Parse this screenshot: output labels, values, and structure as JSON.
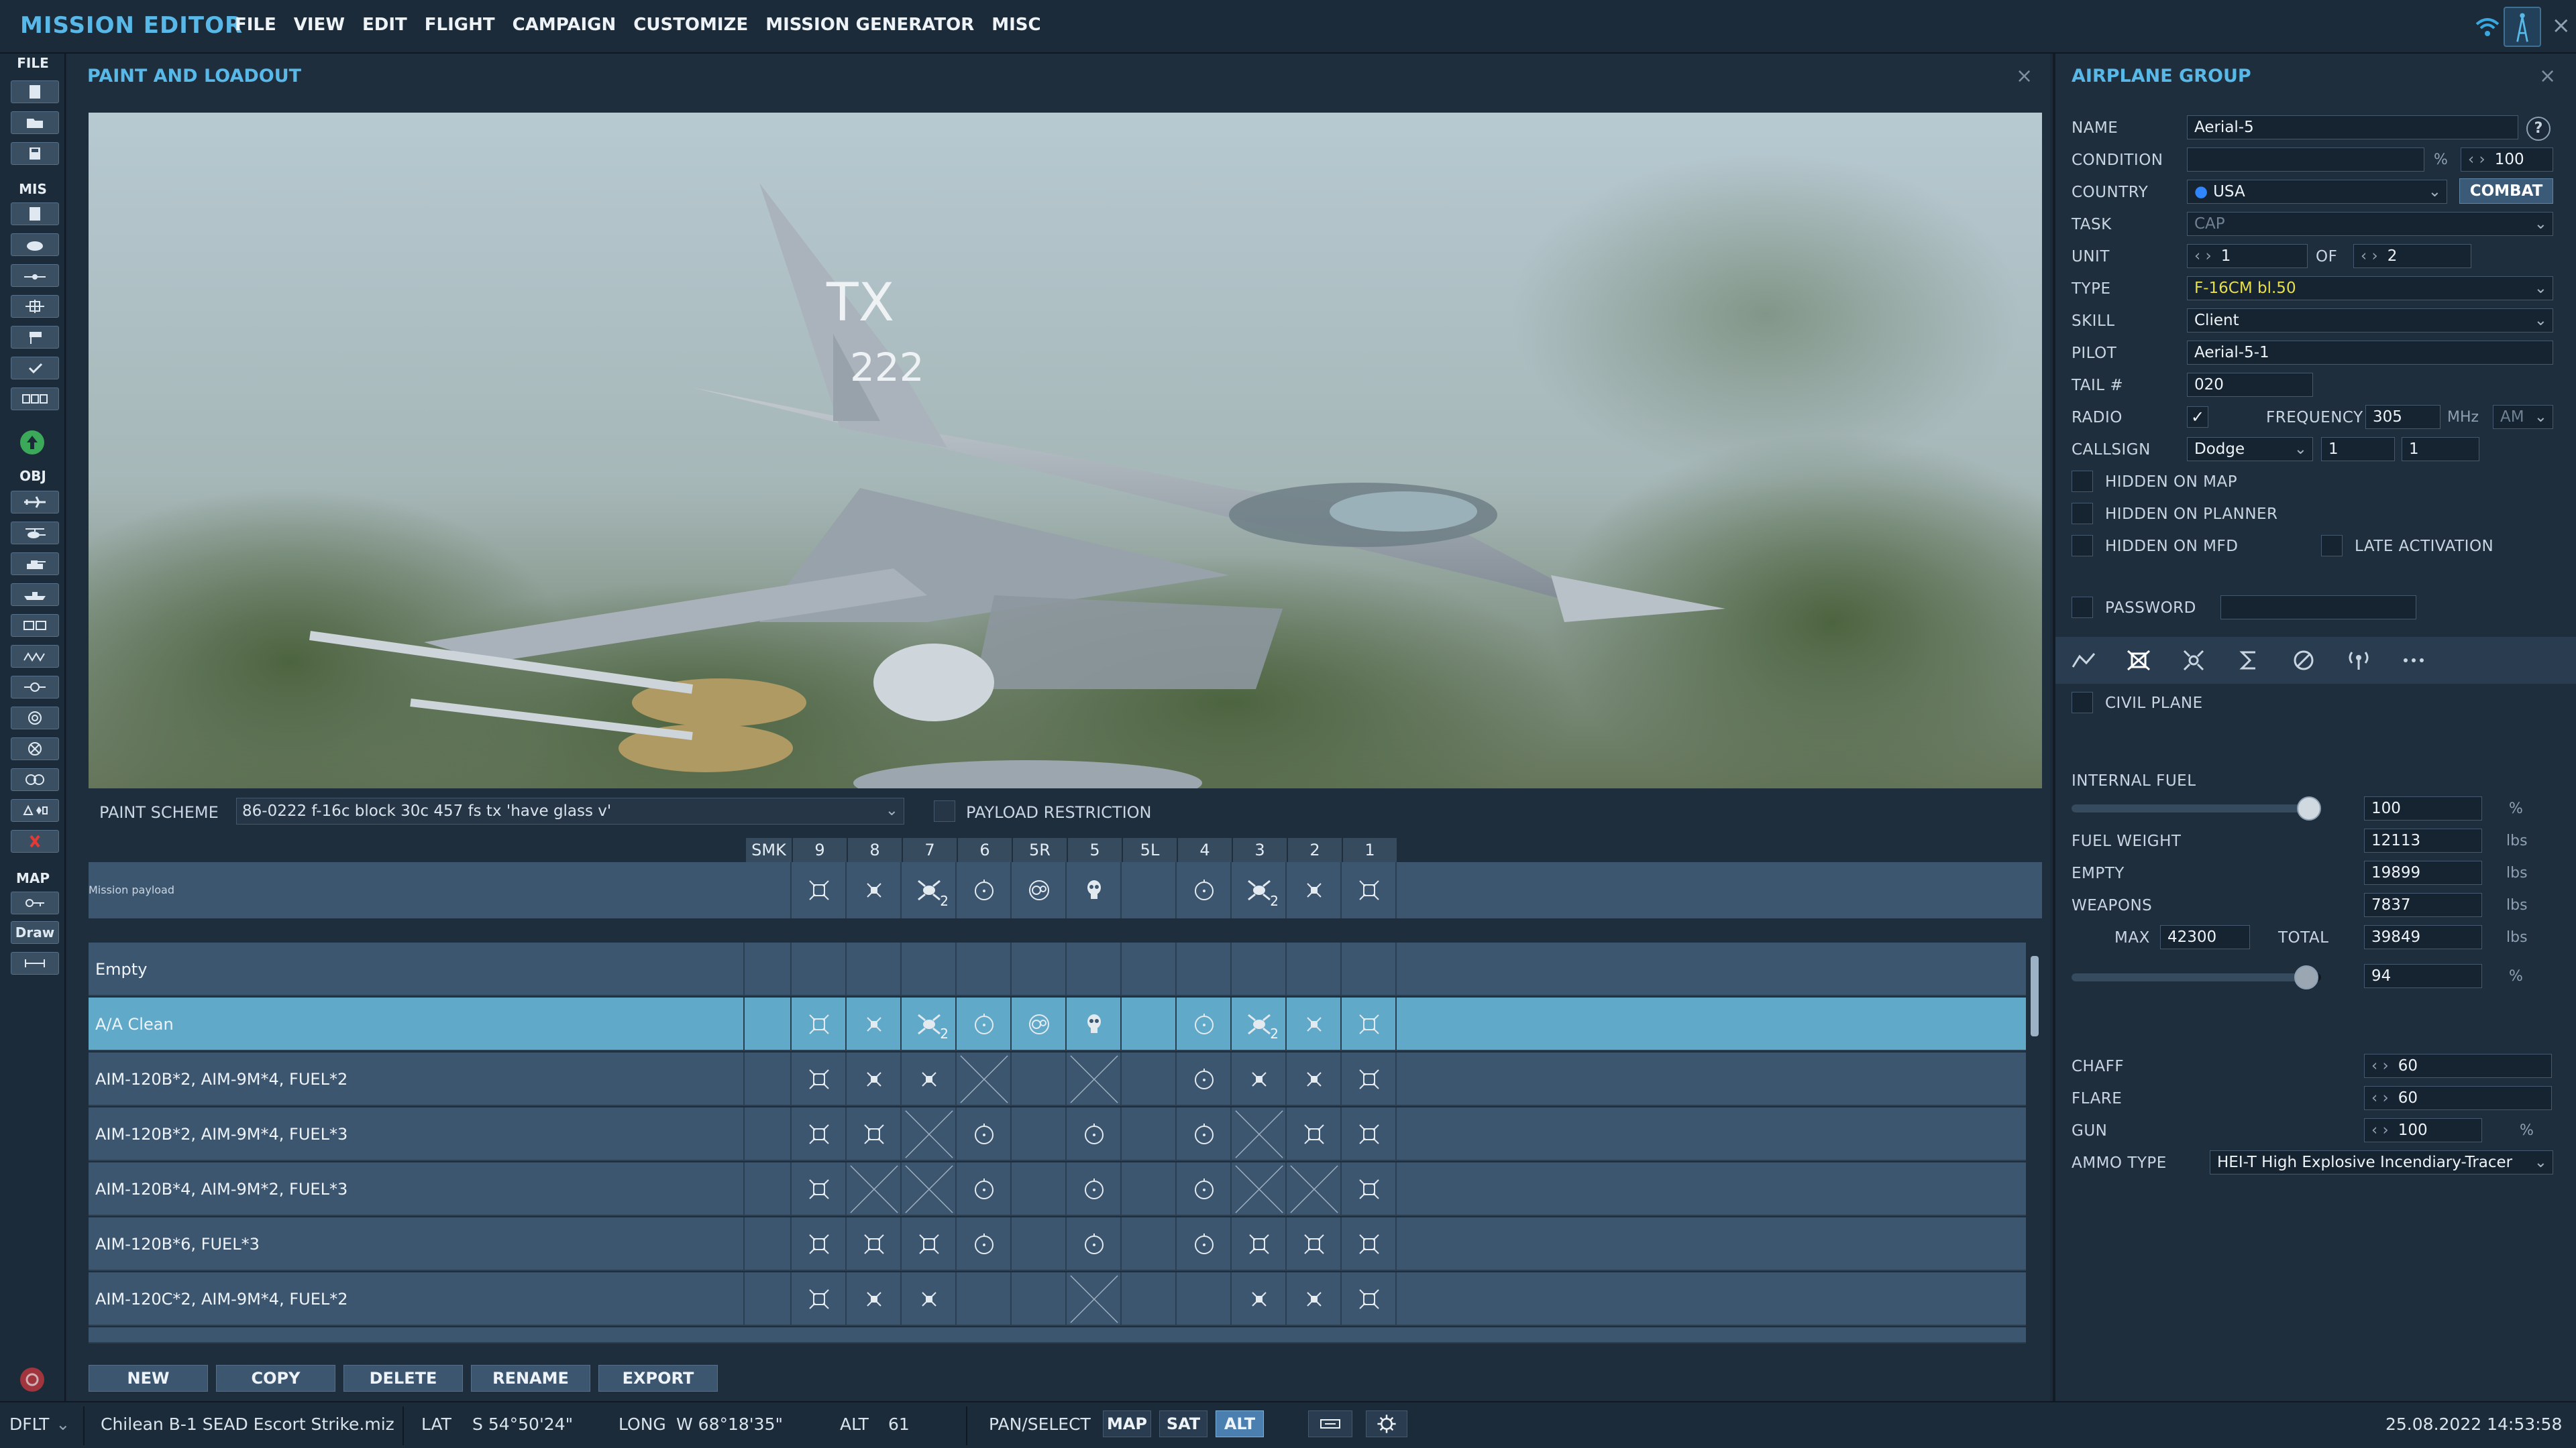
{
  "app": {
    "title": "MISSION EDITOR",
    "menu": [
      "FILE",
      "VIEW",
      "EDIT",
      "FLIGHT",
      "CAMPAIGN",
      "CUSTOMIZE",
      "MISSION GENERATOR",
      "MISC"
    ],
    "close": "×"
  },
  "toolbar": {
    "sections": {
      "file": "FILE",
      "mis": "MIS",
      "obj": "OBJ",
      "map": "MAP"
    },
    "draw_label": "Draw"
  },
  "paint_loadout": {
    "title": "PAINT AND LOADOUT",
    "close": "×",
    "paint_scheme_label": "PAINT SCHEME",
    "paint_scheme_value": "86-0222 f-16c block 30c 457 fs tx 'have glass v'",
    "payload_restriction_label": "PAYLOAD RESTRICTION",
    "aircraft_tail_text": "TX",
    "aircraft_number": "222",
    "columns": [
      "SMK",
      "9",
      "8",
      "7",
      "6",
      "5R",
      "5",
      "5L",
      "4",
      "3",
      "2",
      "1"
    ],
    "mission_payload_label": "Mission payload",
    "rows": [
      {
        "name": "Empty"
      },
      {
        "name": "A/A Clean"
      },
      {
        "name": "AIM-120B*2, AIM-9M*4, FUEL*2"
      },
      {
        "name": "AIM-120B*2, AIM-9M*4, FUEL*3"
      },
      {
        "name": "AIM-120B*4, AIM-9M*2, FUEL*3"
      },
      {
        "name": "AIM-120B*6, FUEL*3"
      },
      {
        "name": "AIM-120C*2, AIM-9M*4, FUEL*2"
      }
    ],
    "sub_count": "2",
    "buttons": [
      "NEW",
      "COPY",
      "DELETE",
      "RENAME",
      "EXPORT"
    ]
  },
  "airplane_group": {
    "title": "AIRPLANE GROUP",
    "close": "×",
    "help": "?",
    "name_label": "NAME",
    "name_value": "Aerial-5",
    "condition_label": "CONDITION",
    "condition_unit": "%",
    "condition_value": "100",
    "country_label": "COUNTRY",
    "country_value": "USA",
    "combat_label": "COMBAT",
    "task_label": "TASK",
    "task_value": "CAP",
    "unit_label": "UNIT",
    "unit_value": "1",
    "of_label": "OF",
    "of_value": "2",
    "type_label": "TYPE",
    "type_value": "F-16CM bl.50",
    "skill_label": "SKILL",
    "skill_value": "Client",
    "pilot_label": "PILOT",
    "pilot_value": "Aerial-5-1",
    "tail_label": "TAIL #",
    "tail_value": "020",
    "radio_label": "RADIO",
    "frequency_label": "FREQUENCY",
    "frequency_value": "305",
    "frequency_unit": "MHz",
    "modulation": "AM",
    "callsign_label": "CALLSIGN",
    "callsign_value": "Dodge",
    "callsign_n1": "1",
    "callsign_n2": "1",
    "hidden_map": "HIDDEN ON MAP",
    "hidden_planner": "HIDDEN ON PLANNER",
    "hidden_mfd": "HIDDEN ON MFD",
    "late_activation": "LATE ACTIVATION",
    "password_label": "PASSWORD",
    "civil_plane": "CIVIL PLANE",
    "internal_fuel_label": "INTERNAL FUEL",
    "internal_fuel_value": "100",
    "percent": "%",
    "fuel_weight_label": "FUEL WEIGHT",
    "fuel_weight_value": "12113",
    "empty_label": "EMPTY",
    "empty_value": "19899",
    "weapons_label": "WEAPONS",
    "weapons_value": "7837",
    "max_label": "MAX",
    "max_value": "42300",
    "total_label": "TOTAL",
    "total_value": "39849",
    "load_percent": "94",
    "lbs": "lbs",
    "chaff_label": "CHAFF",
    "chaff_value": "60",
    "flare_label": "FLARE",
    "flare_value": "60",
    "gun_label": "GUN",
    "gun_value": "100",
    "ammo_label": "AMMO TYPE",
    "ammo_value": "HEI-T High Explosive Incendiary-Tracer",
    "fuel_fraction": 1.0,
    "load_fraction": 0.94
  },
  "status": {
    "profile": "DFLT",
    "file": "Chilean B-1 SEAD Escort Strike.miz",
    "lat_label": "LAT",
    "lat_value": "S 54°50'24\"",
    "long_label": "LONG",
    "long_value": "W 68°18'35\"",
    "alt_label": "ALT",
    "alt_value": "61",
    "mode": "PAN/SELECT",
    "map": "MAP",
    "sat": "SAT",
    "alt_btn": "ALT",
    "datetime": "25.08.2022 14:53:58"
  },
  "colors": {
    "accent": "#58b8e8",
    "selected_row": "#61a9c8",
    "type_highlight": "#e8e04a"
  }
}
